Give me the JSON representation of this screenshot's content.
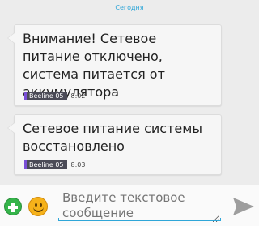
{
  "date_separator": "Сегодня",
  "messages": [
    {
      "text": "Внимание! Сетевое питание отключено, система питается от аккумулятора",
      "sim": "Beeline 05",
      "time": "8:02"
    },
    {
      "text": "Сетевое питание системы восстановлено",
      "sim": "Beeline 05",
      "time": "8:03"
    }
  ],
  "composer": {
    "placeholder": "Введите текстовое сообщение",
    "add_icon": "plus-circle-icon",
    "emoji_icon": "smiley-icon",
    "send_icon": "send-arrow-icon"
  },
  "colors": {
    "accent": "#2fa6d8",
    "add_button": "#35b44a",
    "emoji": "#f6b21a",
    "sim_badge_stripe": "#7a4fd6"
  }
}
